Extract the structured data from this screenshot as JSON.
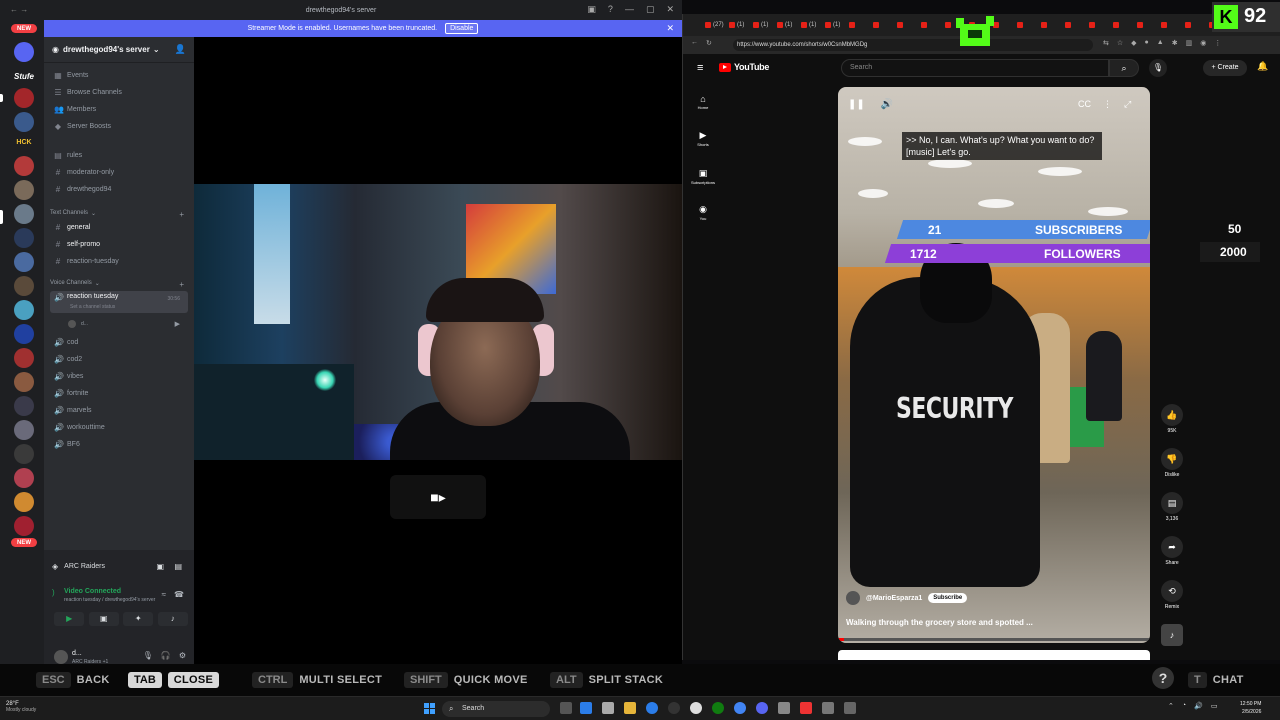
{
  "discord": {
    "window_title": "drewthegod94's server",
    "streamer_banner": {
      "text": "Streamer Mode is enabled. Usernames have been truncated.",
      "button": "Disable"
    },
    "rail": {
      "new_top": "NEW",
      "new_bottom": "NEW",
      "servers": [
        "Stufe",
        "HCK"
      ]
    },
    "server_name": "drewthegod94's server",
    "top_items": [
      "Events",
      "Browse Channels",
      "Members",
      "Server Boosts"
    ],
    "misc_channels": [
      "rules",
      "moderator-only",
      "drewthegod94"
    ],
    "text_category": "Text Channels",
    "text_channels": [
      "general",
      "self-promo",
      "reaction-tuesday"
    ],
    "voice_category": "Voice Channels",
    "active_voice": {
      "name": "reaction tuesday",
      "status": "Set a channel status",
      "timer": "30:56",
      "member": "d..."
    },
    "voice_channels": [
      "cod",
      "cod2",
      "vibes",
      "fortnite",
      "marvels",
      "workouttime",
      "BF6"
    ],
    "game": "ARC Raiders",
    "connection": {
      "status": "Video Connected",
      "detail": "reaction tuesday / drewthegod94's server"
    },
    "user": {
      "name": "d...",
      "activity": "ARC Raiders +1"
    }
  },
  "browser": {
    "url": "https://www.youtube.com/shorts/w0CsnMbMGDg",
    "tab_count_labels": [
      "(27)",
      "(1)",
      "(1)",
      "(1)",
      "(1)",
      "(1)"
    ]
  },
  "youtube": {
    "logo": "YouTube",
    "search_placeholder": "Search",
    "create": "Create",
    "sidebar": [
      {
        "icon": "home-icon",
        "label": "Home"
      },
      {
        "icon": "shorts-icon",
        "label": "Shorts"
      },
      {
        "icon": "subscriptions-icon",
        "label": "Subscriptions"
      },
      {
        "icon": "you-icon",
        "label": "You"
      }
    ],
    "short": {
      "caption": ">> No, I can. What's up? What you want to do? [music] Let's go.",
      "overlay_text": "SECURITY",
      "channel": "@MarioEsparza1",
      "subscribe": "Subscribe",
      "title": "Walking through the grocery store and spotted ...",
      "progress": 0.02
    },
    "actions": [
      {
        "icon": "like-icon",
        "label": "95K"
      },
      {
        "icon": "dislike-icon",
        "label": "Dislike"
      },
      {
        "icon": "comment-icon",
        "label": "3,136"
      },
      {
        "icon": "share-icon",
        "label": "Share"
      },
      {
        "icon": "remix-icon",
        "label": "Remix"
      }
    ]
  },
  "stream_overlay": {
    "subscribers": {
      "current": "21",
      "label": "SUBSCRIBERS",
      "goal": "50"
    },
    "followers": {
      "current": "1712",
      "label": "FOLLOWERS",
      "goal": "2000"
    },
    "viewer_count": "92",
    "platform_letter": "K",
    "accent_sub": "#4d88e0",
    "accent_follow": "#8d3fd8",
    "kick_green": "#53fc18"
  },
  "hotkeys": [
    {
      "key": "ESC",
      "label": "BACK",
      "active": false
    },
    {
      "key": "TAB",
      "label": "CLOSE",
      "active": true
    },
    {
      "key": "CTRL",
      "label": "MULTI SELECT",
      "active": false
    },
    {
      "key": "SHIFT",
      "label": "QUICK MOVE",
      "active": false
    },
    {
      "key": "ALT",
      "label": "SPLIT STACK",
      "active": false
    },
    {
      "key": "T",
      "label": "CHAT",
      "active": false
    }
  ],
  "taskbar": {
    "temperature": "28°F",
    "weather": "Mostly cloudy",
    "search": "Search",
    "time": "12:50 PM",
    "date": "2/5/2026"
  }
}
